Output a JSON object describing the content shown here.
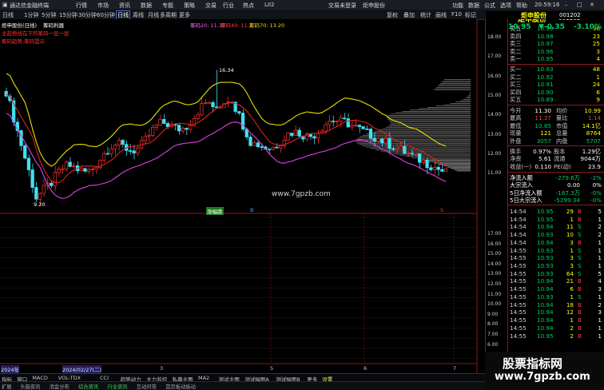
{
  "titlebar": {
    "app_title": "通达信金融终端",
    "menus": [
      "行情",
      "市场",
      "资讯",
      "数据",
      "专题",
      "策略",
      "交易",
      "行业",
      "热点",
      "LII2"
    ],
    "promo_red": "交易未登录",
    "promo_red2": "炬申股份",
    "right_items": [
      "功能",
      "数据",
      "公式",
      "选项",
      "帮助"
    ],
    "time": "20:59:16"
  },
  "menubar": {
    "items": [
      "日线",
      "1分钟",
      "5分钟",
      "15分钟",
      "30分钟",
      "60分钟",
      "日线",
      "周线",
      "月线",
      "多周期",
      "更多"
    ],
    "active_index": 6,
    "right_items": [
      "复权",
      "叠加",
      "统计",
      "画线",
      "F10",
      "标记"
    ]
  },
  "chart": {
    "legend1_name": "炬申股份(日线)",
    "legend1_indicator": "筹码利器",
    "legend2_a": "筹码20: 11.37",
    "legend2_b": "筹码40: 11.2",
    "legend2_c": "筹码70: 13.20",
    "side_note_1": "主趋势线在下的筹码一层一层",
    "side_note_2": "筹码趋势,筹码提示",
    "high_label": "16.34",
    "low_label": "9.20",
    "y_ticks": [
      "18.00",
      "17.00",
      "16.00",
      "15.00",
      "14.00",
      "13.00",
      "12.00",
      "11.00"
    ],
    "lower_y_ticks": [
      "17.00",
      "16.00",
      "15.00",
      "14.00",
      "13.00",
      "12.00",
      "11.00",
      "10.00",
      "9.00",
      "8.00",
      "7.00",
      "6.00",
      "5.00",
      "4.00",
      "3.00"
    ],
    "watermark": "www.7gpzb.com",
    "tag_buy": "涨幅跳",
    "tag_small": "B",
    "tag_red": "S",
    "axis_year": "2024年",
    "axis_date": "2024/02/27(二)",
    "axis_months": [
      "3",
      "4",
      "5",
      "6",
      "7"
    ],
    "colors": {
      "yellow": "#e8e000",
      "red": "#e02020",
      "magenta": "#e040e0",
      "candle_up": "#ff3030",
      "candle_down": "#40e0f0"
    }
  },
  "quote": {
    "name": "炬申股份",
    "code": "001202",
    "price": "10.95",
    "change": "▼-0.35",
    "pct": "-3.10%",
    "asks": [
      {
        "label": "卖五",
        "price": "10.99",
        "vol": "36"
      },
      {
        "label": "卖四",
        "price": "10.98",
        "vol": "23"
      },
      {
        "label": "卖三",
        "price": "10.97",
        "vol": "25"
      },
      {
        "label": "卖二",
        "price": "10.96",
        "vol": "3"
      },
      {
        "label": "卖一",
        "price": "10.95",
        "vol": "4"
      }
    ],
    "bids": [
      {
        "label": "买一",
        "price": "10.93",
        "vol": "48"
      },
      {
        "label": "买二",
        "price": "10.92",
        "vol": "1"
      },
      {
        "label": "买三",
        "price": "10.91",
        "vol": "24"
      },
      {
        "label": "买四",
        "price": "10.90",
        "vol": "6"
      },
      {
        "label": "买五",
        "price": "10.89",
        "vol": "9"
      }
    ],
    "stats": [
      {
        "l1": "今开",
        "v1": "11.30",
        "l2": "均价",
        "v2": "10.99"
      },
      {
        "l1": "最高",
        "v1": "11.37",
        "l2": "量比",
        "v2": "1.14"
      },
      {
        "l1": "最低",
        "v1": "10.85",
        "l2": "市值",
        "v2": "14.1亿"
      },
      {
        "l1": "现量",
        "v1": "121",
        "l2": "总量",
        "v2": "8764"
      },
      {
        "l1": "外盘",
        "v1": "3057",
        "l2": "内盘",
        "v2": "5707"
      }
    ],
    "stats2": [
      {
        "l1": "换手",
        "v1": "0.97%",
        "l2": "股本",
        "v2": "1.29亿"
      },
      {
        "l1": "净资",
        "v1": "5.61",
        "l2": "流通",
        "v2": "9044万"
      },
      {
        "l1": "收益(一)",
        "v1": "0.110",
        "l2": "PE(动)",
        "v2": "23.9"
      }
    ],
    "flows": [
      {
        "label": "净流入额",
        "v1": "-279.6万",
        "v2": "-2%"
      },
      {
        "label": "大宗流入",
        "v1": "0.00",
        "v2": "0%"
      },
      {
        "label": "5日净流入额",
        "v1": "-187.3万",
        "v2": "-0%"
      },
      {
        "label": "5日大宗流入",
        "v1": "-5299.34",
        "v2": "-0%"
      }
    ],
    "ticks": [
      {
        "t": "14:54",
        "p": "10.95",
        "v": "29",
        "d": "B",
        "n": "5"
      },
      {
        "t": "14:54",
        "p": "10.95",
        "v": "1",
        "d": "B",
        "n": "1"
      },
      {
        "t": "14:54",
        "p": "10.94",
        "v": "11",
        "d": "S",
        "n": "2"
      },
      {
        "t": "14:54",
        "p": "10.93",
        "v": "10",
        "d": "S",
        "n": "2"
      },
      {
        "t": "14:54",
        "p": "10.94",
        "v": "3",
        "d": "B",
        "n": "1"
      },
      {
        "t": "14:55",
        "p": "10.93",
        "v": "1",
        "d": "S",
        "n": "1"
      },
      {
        "t": "14:55",
        "p": "10.93",
        "v": "3",
        "d": "S",
        "n": "1"
      },
      {
        "t": "14:55",
        "p": "10.93",
        "v": "3",
        "d": "S",
        "n": "1"
      },
      {
        "t": "14:55",
        "p": "10.93",
        "v": "64",
        "d": "S",
        "n": "5"
      },
      {
        "t": "14:55",
        "p": "10.94",
        "v": "21",
        "d": "B",
        "n": "4"
      },
      {
        "t": "14:55",
        "p": "10.94",
        "v": "6",
        "d": "B",
        "n": "3"
      },
      {
        "t": "14:55",
        "p": "10.93",
        "v": "1",
        "d": "S",
        "n": "1"
      },
      {
        "t": "14:55",
        "p": "10.94",
        "v": "18",
        "d": "B",
        "n": "2"
      },
      {
        "t": "14:55",
        "p": "10.94",
        "v": "12",
        "d": "B",
        "n": "3"
      },
      {
        "t": "14:55",
        "p": "10.94",
        "v": "1",
        "d": "B",
        "n": "1"
      },
      {
        "t": "14:55",
        "p": "10.94",
        "v": "2",
        "d": "B",
        "n": "1"
      },
      {
        "t": "14:55",
        "p": "10.95",
        "v": "2",
        "d": "B",
        "n": "1"
      }
    ]
  },
  "bottom_tabs": [
    "指标",
    "窗口",
    "MACD",
    "VOL-TDX",
    "CCI",
    "趋势动力",
    "主力监控",
    "私募主图",
    "MA2",
    "测试主图",
    "测试幅图A",
    "测试幅图B",
    "更多",
    "设置"
  ],
  "statusbar": [
    "扩展",
    "头脑资讯",
    "消金分布",
    "综合资讯",
    "行业资讯",
    "互动问答",
    "首页板动板动"
  ],
  "brand": {
    "cn": "股票指标网",
    "url": "www.7gpzb.com"
  }
}
